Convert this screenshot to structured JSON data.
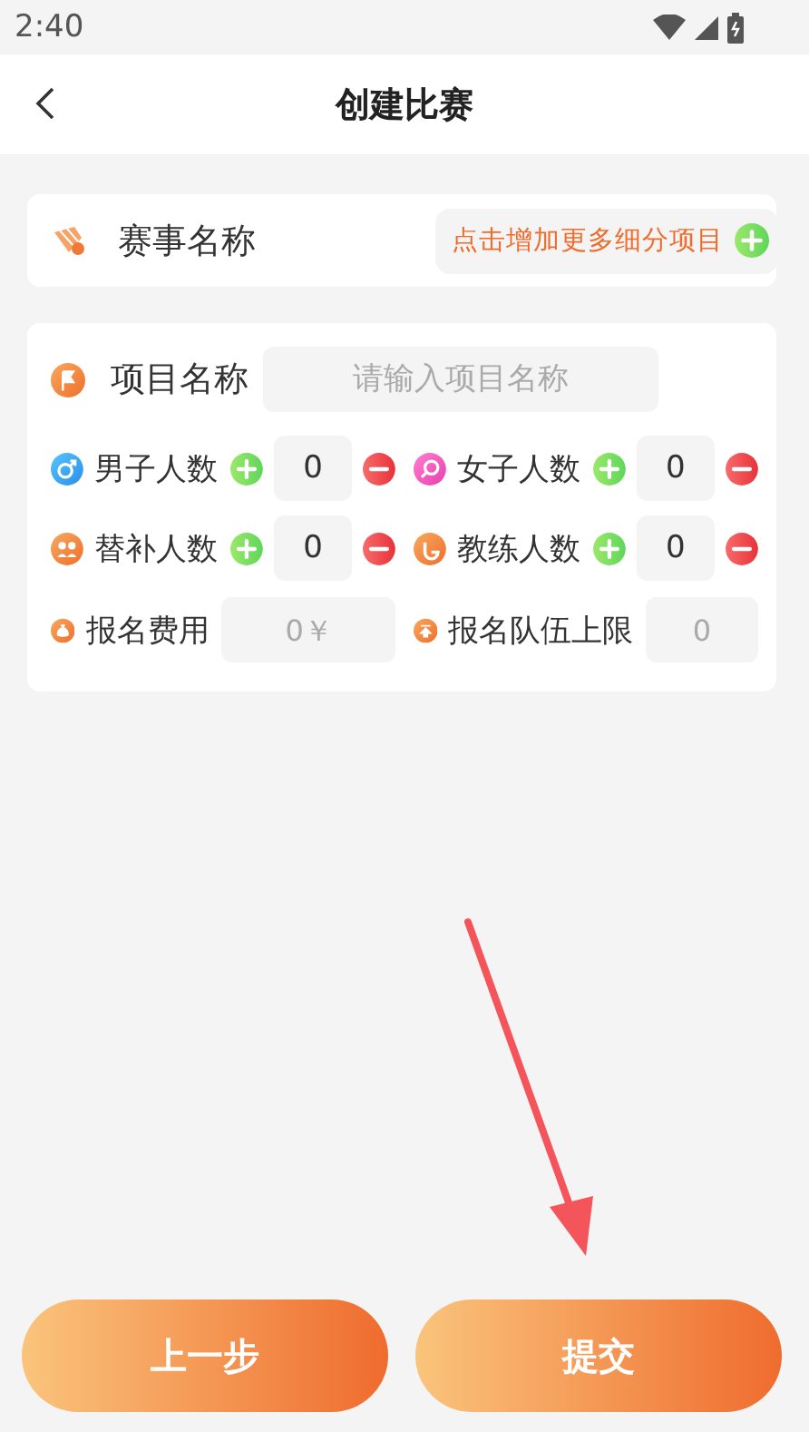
{
  "status_bar": {
    "time": "2:40"
  },
  "header": {
    "title": "创建比赛"
  },
  "event": {
    "label": "赛事名称",
    "add_button": "点击增加更多细分项目"
  },
  "project": {
    "label": "项目名称",
    "placeholder": "请输入项目名称"
  },
  "counters": [
    {
      "label": "男子人数",
      "value": "0"
    },
    {
      "label": "女子人数",
      "value": "0"
    },
    {
      "label": "替补人数",
      "value": "0"
    },
    {
      "label": "教练人数",
      "value": "0"
    }
  ],
  "fees": [
    {
      "label": "报名费用",
      "placeholder": "0￥"
    },
    {
      "label": "报名队伍上限",
      "placeholder": "0"
    }
  ],
  "buttons": [
    "上一步",
    "提交"
  ]
}
